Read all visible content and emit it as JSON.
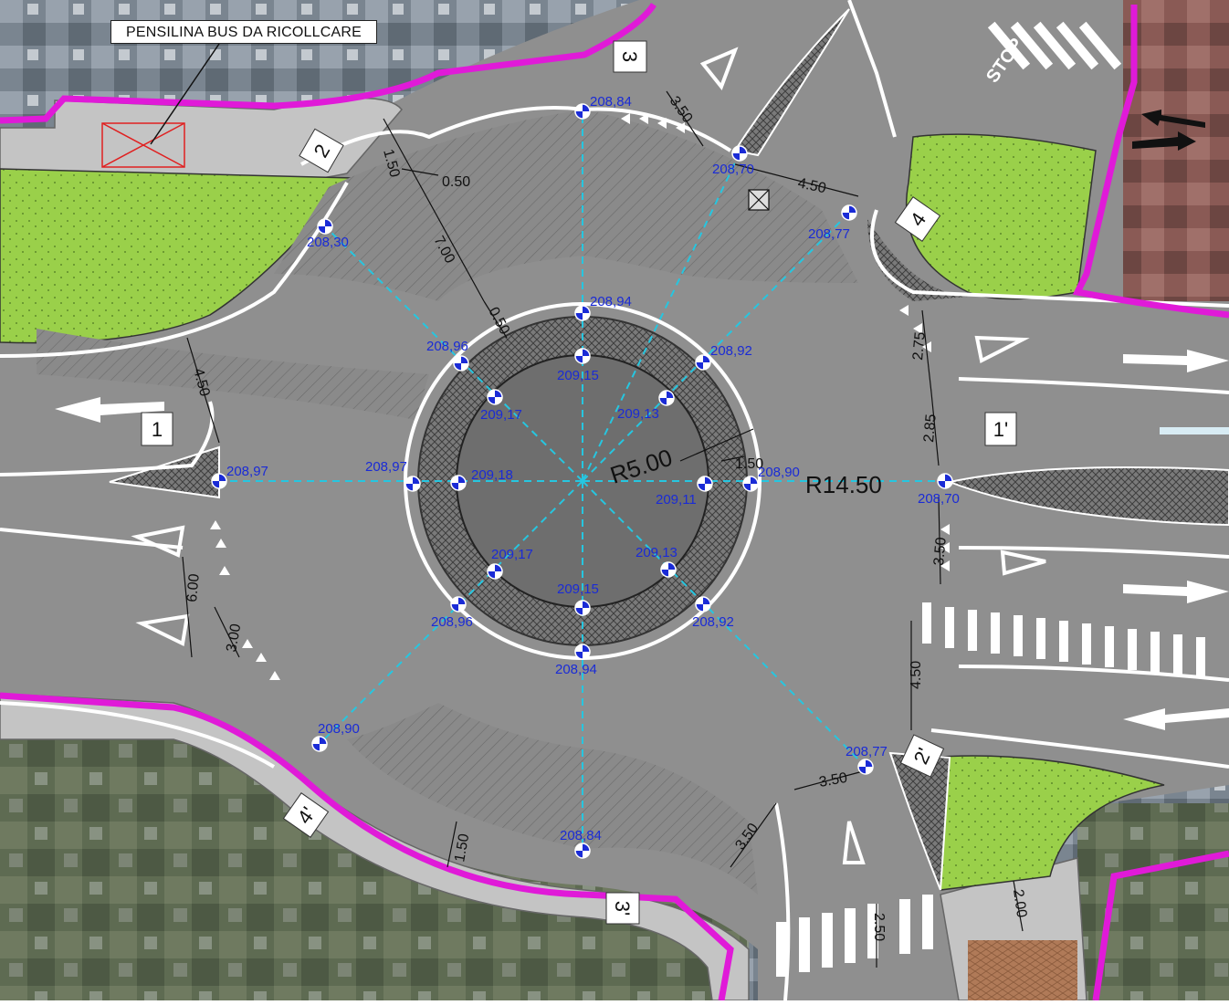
{
  "note": "PENSILINA BUS DA RICOLLCARE",
  "radii": {
    "inner": "R5.00",
    "outer": "R14.50"
  },
  "stop_text": "STOP",
  "section_labels": [
    "1",
    "1'",
    "2",
    "2'",
    "3",
    "3'",
    "4",
    "4'"
  ],
  "dimensions": [
    "1.50",
    "0.50",
    "7.00",
    "0.50",
    "3.50",
    "4.50",
    "4.50",
    "2.75",
    "2.85",
    "1.50",
    "3.50",
    "4.50",
    "6.00",
    "3.00",
    "1.50",
    "3.50",
    "3.50",
    "2.50",
    "2.00"
  ],
  "elevations": {
    "outer_n": "208,84",
    "nw_entry": "208,30",
    "ne_island": "208,70",
    "ne_entry": "208,77",
    "w_entry": "208,97",
    "e_entry": "208,70",
    "sw_entry": "208,90",
    "s_outer": "208,84",
    "se_entry": "208,77",
    "ring_n": "208,94",
    "ring_nw": "208,96",
    "ring_ne": "208,92",
    "ring_w": "208,97",
    "ring_e": "208,90",
    "ring_sw": "208,96",
    "ring_se": "208,92",
    "ring_s": "208,94",
    "isl_n": "209,15",
    "isl_nw": "209,17",
    "isl_ne": "209,13",
    "isl_w": "209,18",
    "isl_e": "209,11",
    "isl_sw": "209,17",
    "isl_se": "209,13",
    "isl_s": "209,15"
  },
  "colors": {
    "asphalt": "#8f8f8f",
    "grass": "#9ad04a",
    "boundary": "#e01ad8",
    "elevation_text": "#1a2bd6",
    "section_line": "#26c6e0"
  }
}
